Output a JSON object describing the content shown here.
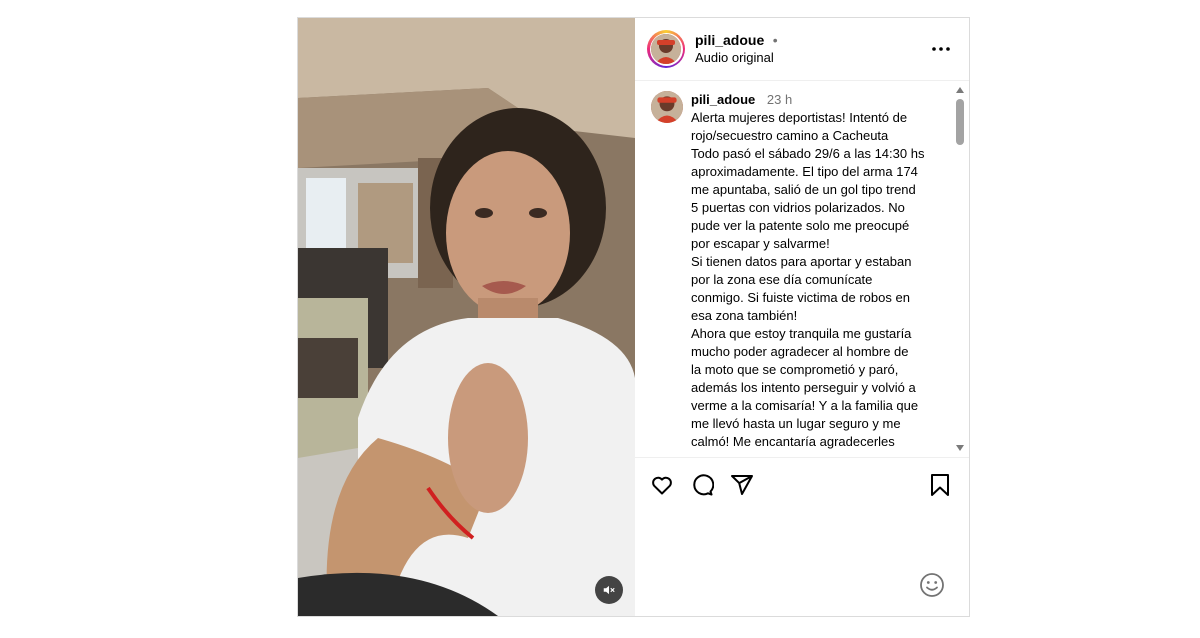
{
  "post": {
    "username": "pili_adoue",
    "separator": "•",
    "audio": "Audio original"
  },
  "caption": {
    "username": "pili_adoue",
    "time": "23 h",
    "lines": [
      "Alerta mujeres deportistas! Intentó de",
      "rojo/secuestro camino a Cacheuta",
      "Todo pasó el sábado 29/6 a las 14:30 hs",
      "aproximadamente. El tipo del arma 174",
      "me apuntaba, salió de un gol tipo trend",
      "5 puertas con vidrios polarizados. No",
      "pude ver la patente solo me preocupé",
      "por escapar y salvarme!",
      "Si tienen datos para aportar y estaban",
      "por la zona ese día comunícate",
      "conmigo. Si fuiste victima de robos en",
      "esa zona también!",
      "Ahora que estoy tranquila me gustaría",
      "mucho poder agradecer al hombre de",
      "la moto que se comprometió y paró,",
      "además los intento perseguir y volvió a",
      "verme a la comisaría! Y a la familia que",
      "me llevó hasta un lugar seguro y me",
      "calmó! Me encantaría agradecerles"
    ]
  },
  "icons": {
    "like": "heart-icon",
    "comment": "comment-icon",
    "share": "share-icon",
    "save": "bookmark-icon",
    "more": "more-icon",
    "mute": "muted-speaker-icon",
    "emoji": "emoji-icon"
  },
  "colors": {
    "border": "#dbdbdb",
    "secondary_text": "#737373"
  }
}
